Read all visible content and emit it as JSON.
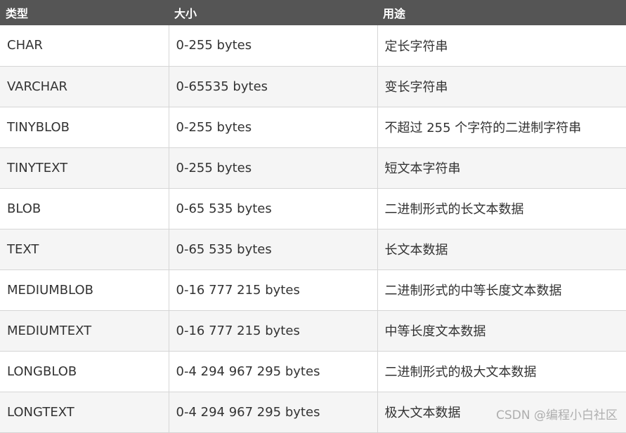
{
  "table": {
    "headers": [
      "类型",
      "大小",
      "用途"
    ],
    "rows": [
      {
        "type": "CHAR",
        "size": "0-255 bytes",
        "usage": "定长字符串"
      },
      {
        "type": "VARCHAR",
        "size": "0-65535 bytes",
        "usage": "变长字符串"
      },
      {
        "type": "TINYBLOB",
        "size": "0-255 bytes",
        "usage": "不超过 255 个字符的二进制字符串"
      },
      {
        "type": "TINYTEXT",
        "size": "0-255 bytes",
        "usage": "短文本字符串"
      },
      {
        "type": "BLOB",
        "size": "0-65 535 bytes",
        "usage": "二进制形式的长文本数据"
      },
      {
        "type": "TEXT",
        "size": "0-65 535 bytes",
        "usage": "长文本数据"
      },
      {
        "type": "MEDIUMBLOB",
        "size": "0-16 777 215 bytes",
        "usage": "二进制形式的中等长度文本数据"
      },
      {
        "type": "MEDIUMTEXT",
        "size": "0-16 777 215 bytes",
        "usage": "中等长度文本数据"
      },
      {
        "type": "LONGBLOB",
        "size": "0-4 294 967 295 bytes",
        "usage": "二进制形式的极大文本数据"
      },
      {
        "type": "LONGTEXT",
        "size": "0-4 294 967 295 bytes",
        "usage": "极大文本数据"
      }
    ]
  },
  "watermark": "CSDN @编程小白社区",
  "colors": {
    "header_bg": "#555555",
    "header_text": "#ffffff",
    "row_alt_bg": "#f5f5f5",
    "cell_text": "#333333",
    "border": "#d6d6d6"
  }
}
